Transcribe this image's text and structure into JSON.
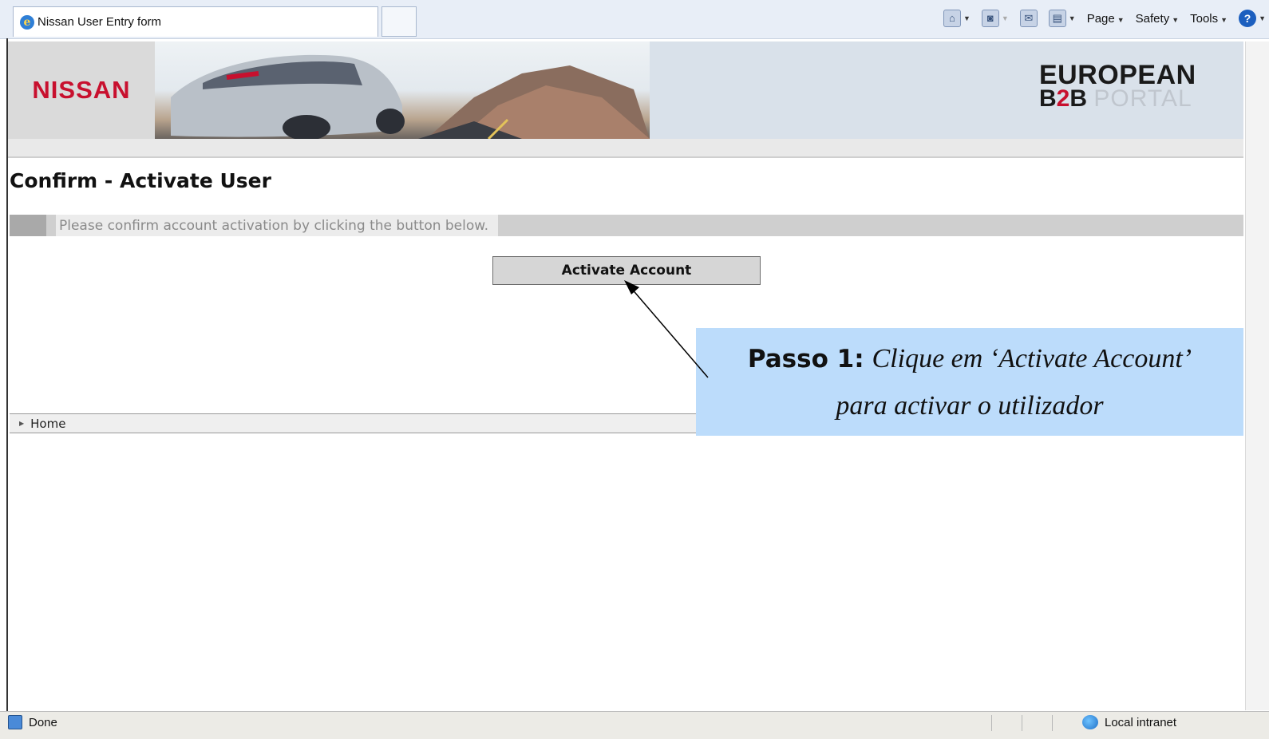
{
  "browser": {
    "tab_title": "Nissan User Entry form",
    "commands": {
      "page_label": "Page",
      "safety_label": "Safety",
      "tools_label": "Tools"
    }
  },
  "banner": {
    "logo_text": "NISSAN",
    "brand_line1": "EUROPEAN",
    "brand_line2_b": "B",
    "brand_line2_2": "2",
    "brand_line2_b2": "B",
    "brand_line2_portal": "PORTAL"
  },
  "page": {
    "heading": "Confirm - Activate User",
    "message": "Please confirm account activation by clicking the button below.",
    "activate_button": "Activate Account",
    "home_link": "Home"
  },
  "callout": {
    "step_label": "Passo 1:",
    "line1": "Clique em ‘Activate Account’",
    "line2": "para activar o utilizador"
  },
  "status": {
    "done": "Done",
    "zone": "Local intranet"
  },
  "colors": {
    "nissan_red": "#c8102e",
    "callout_bg": "#bcdcfb"
  }
}
